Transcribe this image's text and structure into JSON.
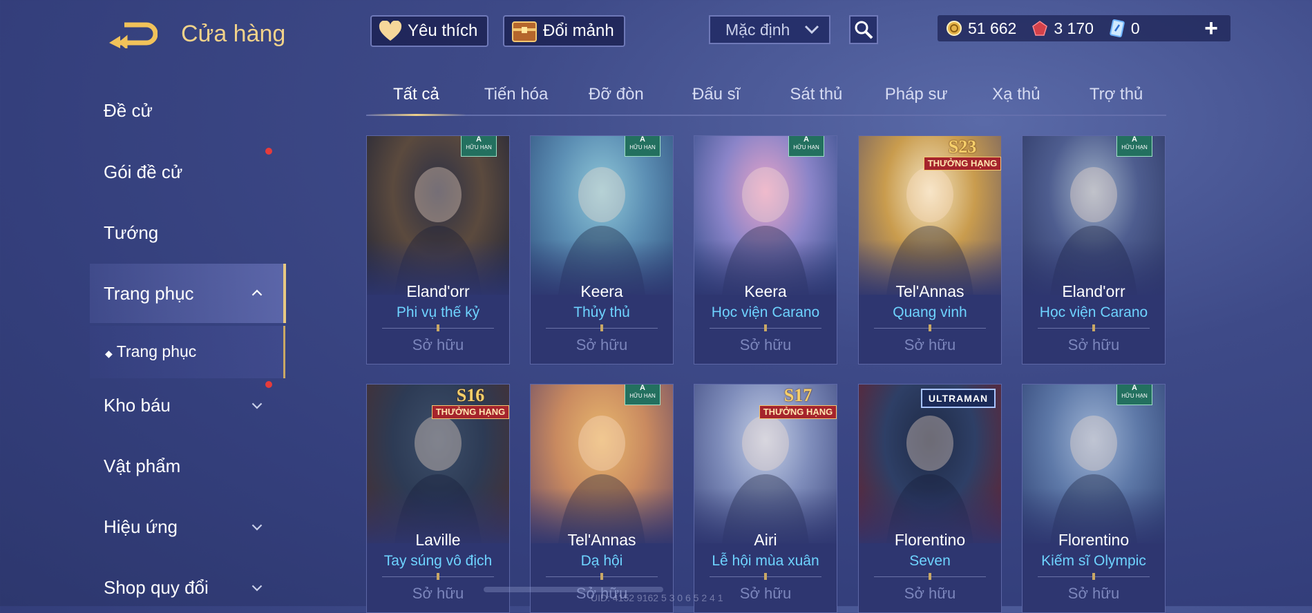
{
  "header": {
    "title": "Cửa hàng",
    "favorites_label": "Yêu thích",
    "exchange_label": "Đổi mảnh",
    "sort_selected": "Mặc định",
    "currencies": [
      {
        "icon": "gold-coin-icon",
        "value": "51 662"
      },
      {
        "icon": "red-gem-icon",
        "value": "3 170"
      },
      {
        "icon": "blue-voucher-icon",
        "value": "0"
      }
    ]
  },
  "sidebar": {
    "items": [
      {
        "label": "Đề cử"
      },
      {
        "label": "Gói đề cử"
      },
      {
        "label": "Tướng"
      },
      {
        "label": "Trang phục"
      },
      {
        "label": "Trang phục"
      },
      {
        "label": "Kho báu"
      },
      {
        "label": "Vật phẩm"
      },
      {
        "label": "Hiệu ứng"
      },
      {
        "label": "Shop quy đổi"
      }
    ]
  },
  "tabs": [
    "Tất cả",
    "Tiến hóa",
    "Đỡ đòn",
    "Đấu sĩ",
    "Sát thủ",
    "Pháp sư",
    "Xạ thủ",
    "Trợ thủ"
  ],
  "cards": [
    {
      "hero": "Eland'orr",
      "skin": "Phi vụ thế kỷ",
      "status": "Sở hữu",
      "badge_top": "A",
      "badge_bottom": "HỮU HẠN",
      "art": [
        "#2b2f45",
        "#5b4a3e",
        "#1d2236"
      ]
    },
    {
      "hero": "Keera",
      "skin": "Thủy thủ",
      "status": "Sở hữu",
      "badge_top": "A",
      "badge_bottom": "HỮU HẠN",
      "art": [
        "#8fc7d8",
        "#5c8fb4",
        "#2f4f7d"
      ]
    },
    {
      "hero": "Keera",
      "skin": "Học viện Carano",
      "status": "Sở hữu",
      "badge_top": "A",
      "badge_bottom": "HỮU HẠN",
      "art": [
        "#e7a4c9",
        "#8a84c8",
        "#304a86"
      ]
    },
    {
      "hero": "Tel'Annas",
      "skin": "Quang vinh",
      "status": "Sở hữu",
      "badge_top": "S23",
      "badge_bottom": "THƯỞNG HẠNG",
      "art": [
        "#f4e5c3",
        "#c99c4e",
        "#6a5a64"
      ]
    },
    {
      "hero": "Eland'orr",
      "skin": "Học viện Carano",
      "status": "Sở hữu",
      "badge_top": "A",
      "badge_bottom": "HỮU HẠN",
      "art": [
        "#9fb0c7",
        "#4e5d8f",
        "#2c3764"
      ]
    },
    {
      "hero": "Laville",
      "skin": "Tay súng vô địch",
      "status": "Sở hữu",
      "badge_top": "S16",
      "badge_bottom": "THƯỞNG HẠNG",
      "art": [
        "#3d4f6a",
        "#2d3b55",
        "#4a2e2e"
      ]
    },
    {
      "hero": "Tel'Annas",
      "skin": "Dạ hội",
      "status": "Sở hữu",
      "badge_top": "A",
      "badge_bottom": "HỮU HẠN",
      "art": [
        "#e9b86e",
        "#c98a60",
        "#6b4c66"
      ]
    },
    {
      "hero": "Airi",
      "skin": "Lễ hội mùa xuân",
      "status": "Sở hữu",
      "badge_top": "S17",
      "badge_bottom": "THƯỞNG HẠNG",
      "art": [
        "#c4cfe6",
        "#7f8dbb",
        "#3f4a80"
      ]
    },
    {
      "hero": "Florentino",
      "skin": "Seven",
      "status": "Sở hữu",
      "badge_top": "ULTRAMAN",
      "badge_bottom": "",
      "art": [
        "#1f2a45",
        "#2e3f66",
        "#6a1f2b"
      ]
    },
    {
      "hero": "Florentino",
      "skin": "Kiếm sĩ Olympic",
      "status": "Sở hữu",
      "badge_top": "A",
      "badge_bottom": "HỮU HẠN",
      "art": [
        "#9db3d4",
        "#5e79a8",
        "#2f4274"
      ]
    }
  ],
  "uid_text": "UID: 4152 9162 5 3 0 6 5 2 4 1",
  "colors": {
    "gold": "#f1d28a",
    "skin_name": "#6ed3ff",
    "accent_red": "#c0262f"
  }
}
